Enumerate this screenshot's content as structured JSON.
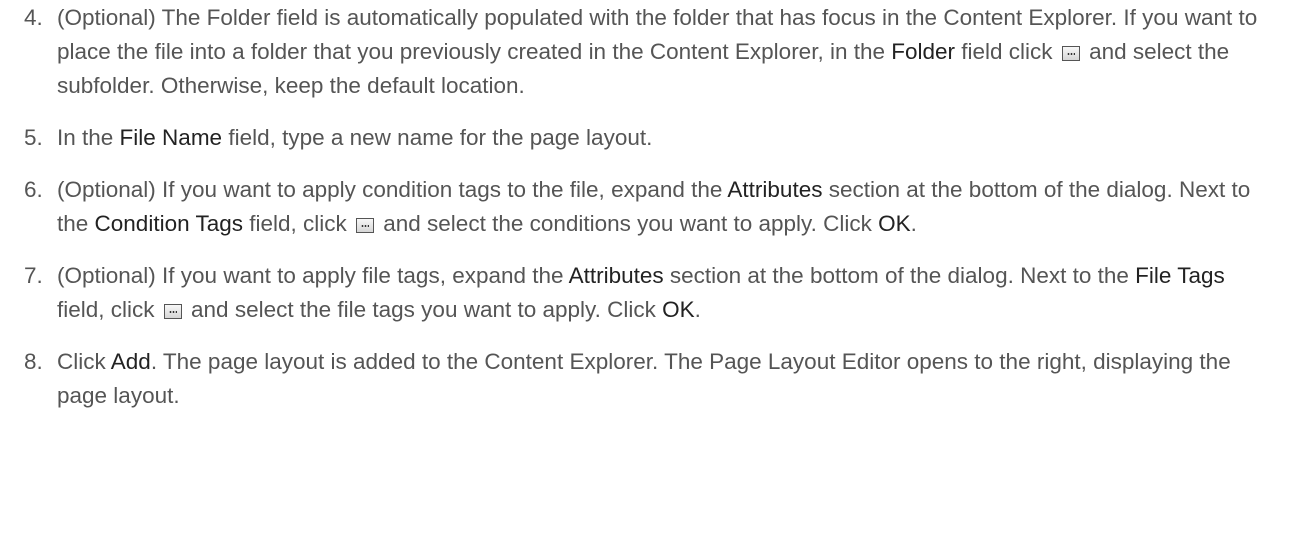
{
  "steps": [
    {
      "num": "4.",
      "parts": [
        {
          "t": "text",
          "v": "(Optional) The Folder field is automatically populated with the folder that has focus in the Content Explorer. If you want to place the file into a folder that you previously created in the Content Explorer, in the "
        },
        {
          "t": "bold",
          "v": "Folder"
        },
        {
          "t": "text",
          "v": " field click "
        },
        {
          "t": "icon",
          "v": "ellipsis-button-icon"
        },
        {
          "t": "text",
          "v": " and select the subfolder. Otherwise, keep the default location."
        }
      ]
    },
    {
      "num": "5.",
      "parts": [
        {
          "t": "text",
          "v": "In the "
        },
        {
          "t": "bold",
          "v": "File Name"
        },
        {
          "t": "text",
          "v": " field, type a new name for the page layout."
        }
      ]
    },
    {
      "num": "6.",
      "parts": [
        {
          "t": "text",
          "v": "(Optional) If you want to apply condition tags to the file, expand the "
        },
        {
          "t": "bold",
          "v": "Attributes"
        },
        {
          "t": "text",
          "v": " section at the bottom of the dialog. Next to the "
        },
        {
          "t": "bold",
          "v": "Condition Tags"
        },
        {
          "t": "text",
          "v": " field, click "
        },
        {
          "t": "icon",
          "v": "ellipsis-button-icon"
        },
        {
          "t": "text",
          "v": " and select the conditions you want to apply. Click "
        },
        {
          "t": "bold",
          "v": "OK"
        },
        {
          "t": "text",
          "v": "."
        }
      ]
    },
    {
      "num": "7.",
      "parts": [
        {
          "t": "text",
          "v": "(Optional) If you want to apply file tags, expand the "
        },
        {
          "t": "bold",
          "v": "Attributes"
        },
        {
          "t": "text",
          "v": " section at the bottom of the dialog. Next to the "
        },
        {
          "t": "bold",
          "v": "File Tags"
        },
        {
          "t": "text",
          "v": " field, click "
        },
        {
          "t": "icon",
          "v": "ellipsis-button-icon"
        },
        {
          "t": "text",
          "v": " and select the file tags you want to apply. Click "
        },
        {
          "t": "bold",
          "v": "OK"
        },
        {
          "t": "text",
          "v": "."
        }
      ]
    },
    {
      "num": "8.",
      "parts": [
        {
          "t": "text",
          "v": "Click "
        },
        {
          "t": "bold",
          "v": "Add"
        },
        {
          "t": "text",
          "v": ". The page layout is added to the Content Explorer. The Page Layout Editor opens to the right, displaying the page layout."
        }
      ]
    }
  ],
  "colors": {
    "text": "#555555",
    "ui_term": "#222222",
    "background": "#ffffff"
  }
}
